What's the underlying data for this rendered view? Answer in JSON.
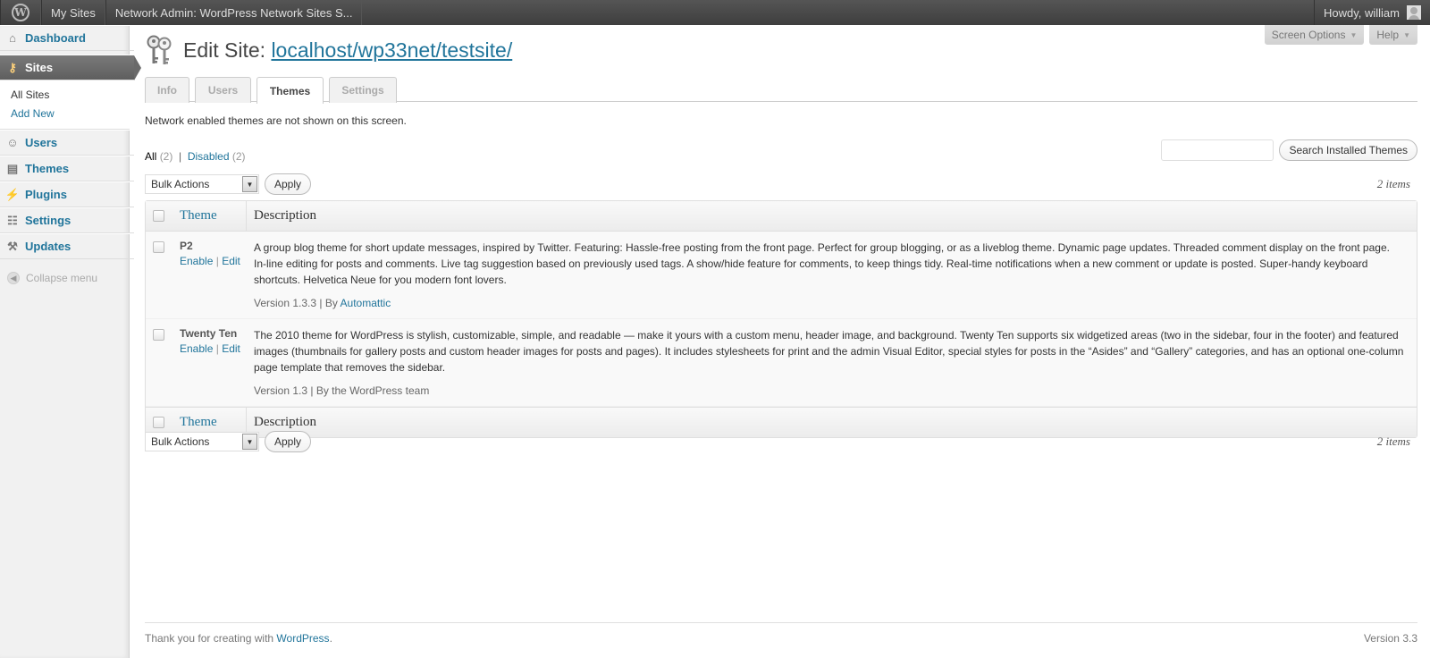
{
  "adminbar": {
    "my_sites": "My Sites",
    "network_title": "Network Admin: WordPress Network Sites S...",
    "howdy": "Howdy, william"
  },
  "menu": {
    "dashboard": "Dashboard",
    "sites": "Sites",
    "sites_sub": [
      "All Sites",
      "Add New"
    ],
    "users": "Users",
    "themes": "Themes",
    "plugins": "Plugins",
    "settings": "Settings",
    "updates": "Updates",
    "collapse": "Collapse menu"
  },
  "screen_meta": {
    "screen_options": "Screen Options",
    "help": "Help"
  },
  "page": {
    "title_prefix": "Edit Site:",
    "site_url": "localhost/wp33net/testsite/",
    "tabs": [
      "Info",
      "Users",
      "Themes",
      "Settings"
    ],
    "active_tab": "Themes",
    "notice": "Network enabled themes are not shown on this screen."
  },
  "filters": {
    "all_label": "All",
    "all_count": "(2)",
    "separator": "|",
    "disabled_label": "Disabled",
    "disabled_count": "(2)"
  },
  "search": {
    "value": "",
    "button": "Search Installed Themes"
  },
  "tablenav": {
    "bulk_actions": "Bulk Actions",
    "apply": "Apply",
    "items": "2 items"
  },
  "table": {
    "columns": {
      "theme": "Theme",
      "description": "Description"
    },
    "rows": [
      {
        "name": "P2",
        "enable": "Enable",
        "sep": "|",
        "edit": "Edit",
        "description": "A group blog theme for short update messages, inspired by Twitter. Featuring: Hassle-free posting from the front page. Perfect for group blogging, or as a liveblog theme. Dynamic page updates. Threaded comment display on the front page. In-line editing for posts and comments. Live tag suggestion based on previously used tags. A show/hide feature for comments, to keep things tidy. Real-time notifications when a new comment or update is posted. Super-handy keyboard shortcuts. Helvetica Neue for you modern font lovers.",
        "version": "Version 1.3.3 | By",
        "author": "Automattic"
      },
      {
        "name": "Twenty Ten",
        "enable": "Enable",
        "sep": "|",
        "edit": "Edit",
        "description": "The 2010 theme for WordPress is stylish, customizable, simple, and readable — make it yours with a custom menu, header image, and background. Twenty Ten supports six widgetized areas (two in the sidebar, four in the footer) and featured images (thumbnails for gallery posts and custom header images for posts and pages). It includes stylesheets for print and the admin Visual Editor, special styles for posts in the “Asides” and “Gallery” categories, and has an optional one-column page template that removes the sidebar.",
        "version": "Version 1.3 | By the WordPress team",
        "author": ""
      }
    ]
  },
  "footer": {
    "thanks": "Thank you for creating with",
    "wordpress": "WordPress",
    "period": ".",
    "version": "Version 3.3"
  },
  "colors": {
    "link": "#21759b",
    "adminbar": "#464646",
    "current_menu": "#6a6a6a"
  },
  "icons": [
    "wordpress-logo-icon",
    "dashboard-icon",
    "sites-icon",
    "users-icon",
    "themes-icon",
    "plugins-icon",
    "settings-icon",
    "updates-icon",
    "collapse-icon",
    "keys-icon",
    "avatar-icon"
  ]
}
